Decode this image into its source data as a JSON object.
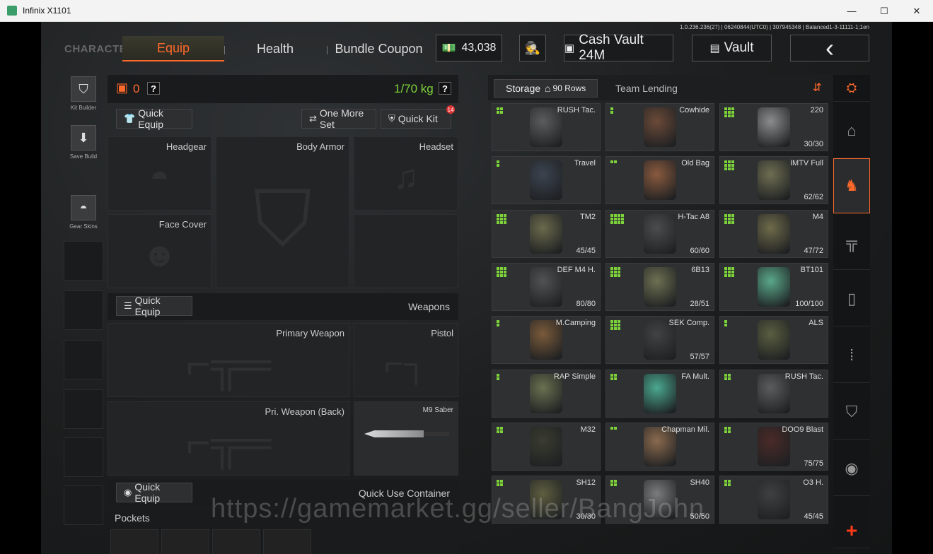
{
  "window": {
    "title": "Infinix X1101",
    "min": "—",
    "max": "☐",
    "close": "✕"
  },
  "version": "1.0.236.236(27) | 06240844(UTC0) | 307945348 | Balanced1-3-11111-1;1en",
  "tabs": {
    "character": "CHARACTER",
    "equip": "Equip",
    "health": "Health",
    "bundle": "Bundle Coupon"
  },
  "currency": {
    "amount": "43,038"
  },
  "header": {
    "cash_vault": "Cash Vault 24M",
    "vault": "Vault",
    "back": "‹"
  },
  "side_tools": [
    {
      "label": "Kit Builder",
      "icon": "vest-icon"
    },
    {
      "label": "Save Build",
      "icon": "download-icon"
    },
    {
      "label": "Gear Skins",
      "icon": "helmet-icon"
    }
  ],
  "loadout": {
    "backpack_count": "0",
    "weight": "1/70 kg",
    "help": "?",
    "quick_equip": "Quick Equip",
    "one_more_set": "One More Set",
    "quick_kit": "Quick Kit",
    "quick_kit_badge": "14",
    "slots": {
      "headgear": "Headgear",
      "body_armor": "Body Armor",
      "headset": "Headset",
      "face_cover": "Face Cover"
    },
    "weapons": {
      "quick_equip": "Quick Equip",
      "title": "Weapons",
      "primary": "Primary Weapon",
      "pistol": "Pistol",
      "primary_back": "Pri. Weapon (Back)",
      "melee": "M9 Saber"
    },
    "container": {
      "quick_equip": "Quick Equip",
      "title": "Quick Use Container"
    },
    "pockets": "Pockets"
  },
  "storage": {
    "tab_storage": "Storage",
    "rows": "90 Rows",
    "tab_lending": "Team Lending",
    "items": [
      {
        "name": "RUSH Tac.",
        "dur": "",
        "dots": 4,
        "cols": 2,
        "color": "#5a5c5e"
      },
      {
        "name": "Cowhide",
        "dur": "",
        "dots": 2,
        "cols": 1,
        "color": "#6b4a38"
      },
      {
        "name": "220",
        "dur": "30/30",
        "dots": 9,
        "cols": 3,
        "color": "#8a8c8e"
      },
      {
        "name": "Travel",
        "dur": "",
        "dots": 2,
        "cols": 1,
        "color": "#3c4450"
      },
      {
        "name": "Old Bag",
        "dur": "",
        "dots": 2,
        "cols": 2,
        "color": "#8a5a3e"
      },
      {
        "name": "IMTV Full",
        "dur": "62/62",
        "dots": 9,
        "cols": 3,
        "color": "#6e6e52"
      },
      {
        "name": "TM2",
        "dur": "45/45",
        "dots": 9,
        "cols": 3,
        "color": "#6a6a4c"
      },
      {
        "name": "H-Tac A8",
        "dur": "60/60",
        "dots": 12,
        "cols": 4,
        "color": "#4a4c4e"
      },
      {
        "name": "M4",
        "dur": "47/72",
        "dots": 9,
        "cols": 3,
        "color": "#6e6a4a"
      },
      {
        "name": "DEF M4 H.",
        "dur": "80/80",
        "dots": 9,
        "cols": 3,
        "color": "#505254"
      },
      {
        "name": "6B13",
        "dur": "28/51",
        "dots": 9,
        "cols": 3,
        "color": "#6e7052"
      },
      {
        "name": "BT101",
        "dur": "100/100",
        "dots": 9,
        "cols": 3,
        "color": "#5aa88a"
      },
      {
        "name": "M.Camping",
        "dur": "",
        "dots": 2,
        "cols": 1,
        "color": "#7a5a3a"
      },
      {
        "name": "SEK Comp.",
        "dur": "57/57",
        "dots": 9,
        "cols": 3,
        "color": "#404244"
      },
      {
        "name": "ALS",
        "dur": "",
        "dots": 2,
        "cols": 1,
        "color": "#5a5e40"
      },
      {
        "name": "RAP Simple",
        "dur": "",
        "dots": 2,
        "cols": 1,
        "color": "#6a7050"
      },
      {
        "name": "FA Mult.",
        "dur": "",
        "dots": 4,
        "cols": 2,
        "color": "#4aa890"
      },
      {
        "name": "RUSH Tac.",
        "dur": "",
        "dots": 4,
        "cols": 2,
        "color": "#5a5c5e"
      },
      {
        "name": "M32",
        "dur": "",
        "dots": 4,
        "cols": 2,
        "color": "#3a3c30"
      },
      {
        "name": "Chapman Mil.",
        "dur": "",
        "dots": 2,
        "cols": 2,
        "color": "#8a6a4e"
      },
      {
        "name": "DOO9 Blast",
        "dur": "75/75",
        "dots": 4,
        "cols": 2,
        "color": "#4a2a28"
      },
      {
        "name": "SH12",
        "dur": "30/30",
        "dots": 4,
        "cols": 2,
        "color": "#5e5e40"
      },
      {
        "name": "SH40",
        "dur": "50/50",
        "dots": 4,
        "cols": 2,
        "color": "#7a7c7e"
      },
      {
        "name": "O3 H.",
        "dur": "45/45",
        "dots": 4,
        "cols": 2,
        "color": "#3e4042"
      }
    ]
  },
  "right_nav": [
    "home-icon",
    "gear-category-icon",
    "rifle-icon",
    "magazine-icon",
    "ammo-icon",
    "armor-icon",
    "grenade-icon"
  ],
  "add": "+",
  "watermark": "https://gamemarket.gg/seller/BangJohn"
}
